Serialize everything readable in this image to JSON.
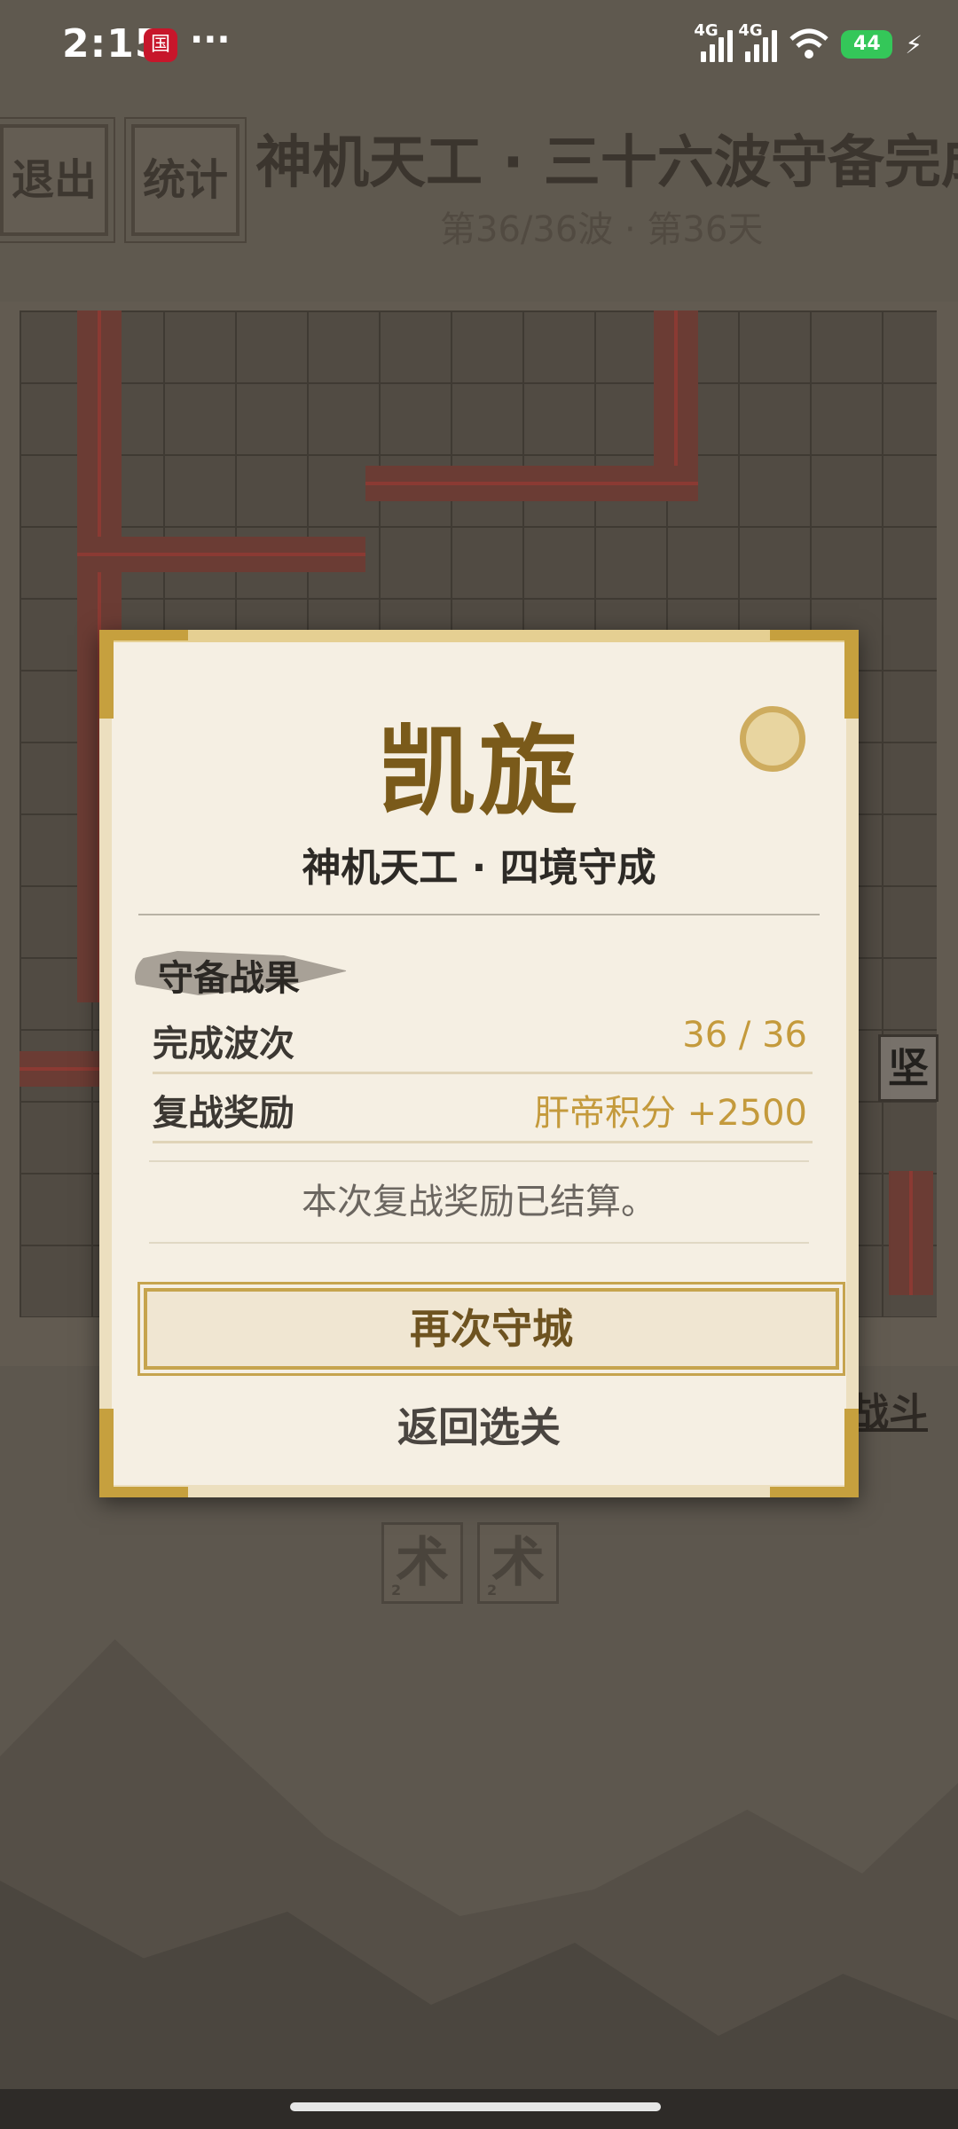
{
  "status_bar": {
    "time": "2:15",
    "app_icon": "国",
    "more": "···",
    "network1": "4G",
    "network2": "4G",
    "battery": "44"
  },
  "game": {
    "exit_label": "退出",
    "stats_label": "统计",
    "title": "神机天工 · 三十六波守备完成",
    "subtitle": "第36/36波 · 第36天",
    "tile_label": "坚",
    "link_label": "战斗",
    "skills": [
      {
        "label": "术",
        "level": "2"
      },
      {
        "label": "术",
        "level": "2"
      }
    ]
  },
  "dialog": {
    "title": "凯旋",
    "subtitle": "神机天工 · 四境守成",
    "section": "守备战果",
    "rows": [
      {
        "label": "完成波次",
        "value": "36 / 36"
      },
      {
        "label": "复战奖励",
        "value": "肝帝积分 +2500"
      }
    ],
    "notice": "本次复战奖励已结算。",
    "again_button": "再次守城",
    "back_button": "返回选关"
  },
  "colors": {
    "accent_gold": "#c49a3c",
    "title_brown": "#7a5a1a",
    "dialog_bg": "#f5efe3"
  }
}
